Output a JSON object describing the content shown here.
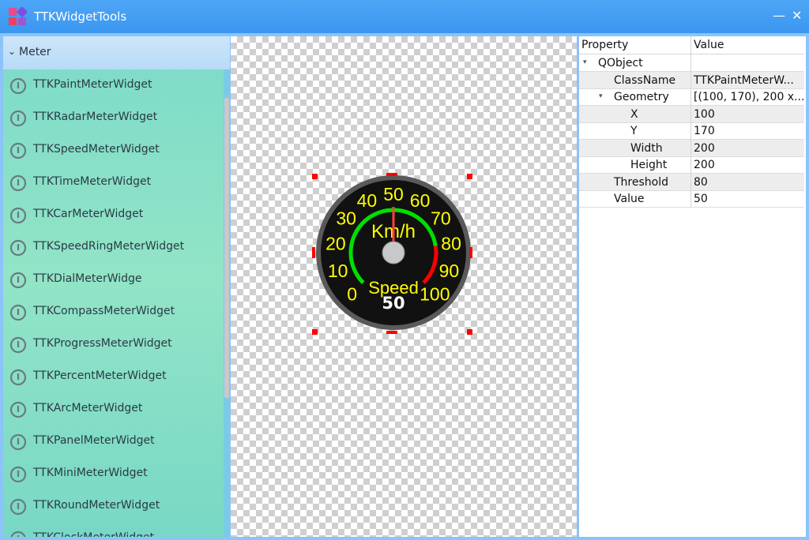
{
  "window": {
    "title": "TTKWidgetTools",
    "minimize_glyph": "—",
    "close_glyph": "✕",
    "accent": "#3a96f0"
  },
  "toolbox": {
    "group_label": "Meter",
    "items": [
      {
        "label": "TTKPaintMeterWidget"
      },
      {
        "label": "TTKRadarMeterWidget"
      },
      {
        "label": "TTKSpeedMeterWidget"
      },
      {
        "label": "TTKTimeMeterWidget"
      },
      {
        "label": "TTKCarMeterWidget"
      },
      {
        "label": "TTKSpeedRingMeterWidget"
      },
      {
        "label": "TTKDialMeterWidge"
      },
      {
        "label": "TTKCompassMeterWidget"
      },
      {
        "label": "TTKProgressMeterWidget"
      },
      {
        "label": "TTKPercentMeterWidget"
      },
      {
        "label": "TTKArcMeterWidget"
      },
      {
        "label": "TTKPanelMeterWidget"
      },
      {
        "label": "TTKMiniMeterWidget"
      },
      {
        "label": "TTKRoundMeterWidget"
      },
      {
        "label": "TTKClockMeterWidget"
      }
    ],
    "item_icon": "gauge-icon"
  },
  "meter": {
    "scale_labels": [
      "0",
      "10",
      "20",
      "30",
      "40",
      "50",
      "60",
      "70",
      "80",
      "90",
      "100"
    ],
    "min": 0,
    "max": 100,
    "unit": "Km/h",
    "caption": "Speed",
    "value_text": "50",
    "value": 50,
    "threshold": 80,
    "colors": {
      "normal": "#00e000",
      "alarm": "#ff0000",
      "text": "#ffff00",
      "needle": "#ff4040"
    }
  },
  "properties": {
    "header": {
      "property": "Property",
      "value": "Value"
    },
    "rows": [
      {
        "key": "QObject",
        "value": "",
        "level": 0,
        "expander": "▾"
      },
      {
        "key": "ClassName",
        "value": "TTKPaintMeterW...",
        "level": 1,
        "expander": ""
      },
      {
        "key": "Geometry",
        "value": "[(100, 170), 200 x...",
        "level": 1,
        "expander": "▾"
      },
      {
        "key": "X",
        "value": "100",
        "level": 2,
        "expander": ""
      },
      {
        "key": "Y",
        "value": "170",
        "level": 2,
        "expander": ""
      },
      {
        "key": "Width",
        "value": "200",
        "level": 2,
        "expander": ""
      },
      {
        "key": "Height",
        "value": "200",
        "level": 2,
        "expander": ""
      },
      {
        "key": "Threshold",
        "value": "80",
        "level": 1,
        "expander": ""
      },
      {
        "key": "Value",
        "value": "50",
        "level": 1,
        "expander": ""
      }
    ]
  }
}
